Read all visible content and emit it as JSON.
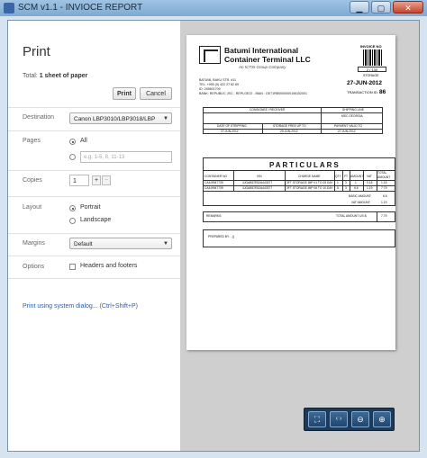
{
  "window": {
    "title": "SCM v1.1 - INVIOCE REPORT"
  },
  "panel": {
    "title": "Print",
    "total_label": "Total: ",
    "total_value": "1 sheet of paper",
    "print_button": "Print",
    "cancel_button": "Cancel",
    "destination": {
      "label": "Destination",
      "value": "Canon LBP3010/LBP3018/LBP"
    },
    "pages": {
      "label": "Pages",
      "all": "All",
      "range_placeholder": "e.g. 1-5, 8, 11-13"
    },
    "copies": {
      "label": "Copies",
      "value": "1",
      "plus": "+",
      "minus": "−"
    },
    "layout": {
      "label": "Layout",
      "portrait": "Portrait",
      "landscape": "Landscape"
    },
    "margins": {
      "label": "Margins",
      "value": "Default"
    },
    "options": {
      "label": "Options",
      "headers_footers": "Headers and footers"
    },
    "system_dialog": "Print using system dialog... (Ctrl+Shift+P)"
  },
  "invoice": {
    "company_line1": "Batumi International",
    "company_line2": "Container Terminal LLC",
    "affiliate": "An ICTSI Group Company",
    "addr1": "BATUMI, BAKU STR. #11",
    "addr2": "TEL: +995 (0) 422 27 62 69",
    "addr3": "ID: 245601709",
    "addr4": "BANK: REPUBLIC JSC - REPLGE22 - IBAN : GE71RB0000000106152001",
    "invoice_no_label": "INVOICE NO",
    "barcode_number": "2 / 130",
    "storage_label": "STORAGE",
    "date": "27-JUN-2012",
    "transaction_label": "TRANSACTION ID:",
    "transaction_id": "86",
    "consignee_header": "CONSIGNEE / RECEIVER",
    "shipping_line_header": "SHIPPING LINE",
    "shipping_line_value": "MSC GEORGIA",
    "date_stripping_header": "DATE OF STRIPPING",
    "date_stripping_value": "27-JUN-2012",
    "storage_free_header": "STORAGE FREE UP TO",
    "storage_free_value": "29-JUN-2012",
    "payment_valid_header": "PAYMENT VALID TO",
    "payment_valid_value": "27-JUN-2012",
    "particulars_title": "PARTICULARS",
    "columns": [
      "CONTAINER NO",
      "VIN",
      "CHARGE NAME",
      "QTY",
      "FT",
      "AMOUNT",
      "VAT",
      "TOTAL AMOUNT"
    ],
    "rows": [
      [
        "CAIU9947739",
        "4JGAB57E52A443377",
        "3FT STORAGE IMP 01 TO 05 DAY",
        "1",
        "3",
        "1",
        "0.18",
        "1.18"
      ],
      [
        "CAIU9947739",
        "4JGAB57E52A443377",
        "3FT STORAGE IMP 06 TO 10 DAY",
        "5",
        "3",
        "6.6",
        "1.19",
        "7.79"
      ]
    ],
    "basic_amount_label": "BASIC AMOUNT:",
    "basic_amount_value": "6.6",
    "vat_amount_label": "VAT AMOUNT:",
    "vat_amount_value": "1.19",
    "remarks_label": "REMARKS:",
    "total_amount_label": "TOTAL AMOUNT US $:",
    "total_amount_value": "7.79",
    "prepared_by": "PREPARED BY: - ()"
  },
  "toolbar": {
    "fit_icon": "fit-page-icon",
    "prev_icon": "nav-arrows-icon",
    "zoom_out_icon": "zoom-out-icon",
    "zoom_in_icon": "zoom-in-icon"
  }
}
